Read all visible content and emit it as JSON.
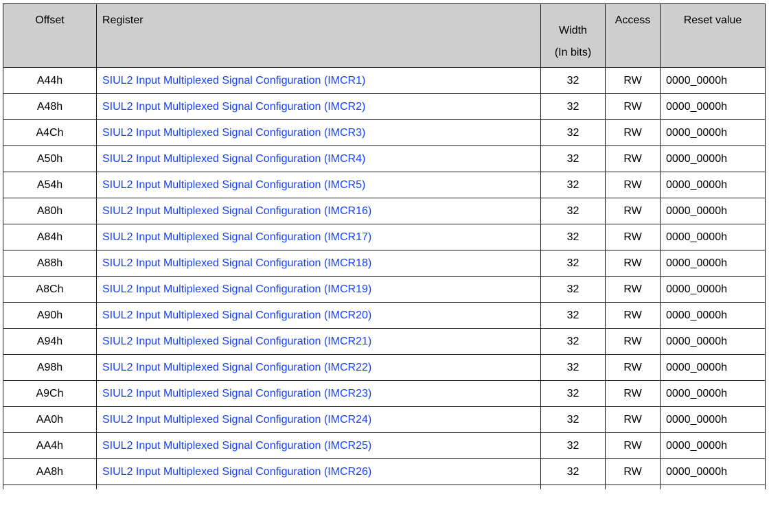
{
  "table": {
    "headers": {
      "offset": "Offset",
      "register": "Register",
      "width_line1": "Width",
      "width_line2": "(In bits)",
      "access": "Access",
      "reset": "Reset value"
    },
    "rows": [
      {
        "offset": "A44h",
        "register": "SIUL2 Input Multiplexed Signal Configuration (IMCR1)",
        "width": "32",
        "access": "RW",
        "reset": "0000_0000h"
      },
      {
        "offset": "A48h",
        "register": "SIUL2 Input Multiplexed Signal Configuration (IMCR2)",
        "width": "32",
        "access": "RW",
        "reset": "0000_0000h"
      },
      {
        "offset": "A4Ch",
        "register": "SIUL2 Input Multiplexed Signal Configuration (IMCR3)",
        "width": "32",
        "access": "RW",
        "reset": "0000_0000h"
      },
      {
        "offset": "A50h",
        "register": "SIUL2 Input Multiplexed Signal Configuration (IMCR4)",
        "width": "32",
        "access": "RW",
        "reset": "0000_0000h"
      },
      {
        "offset": "A54h",
        "register": "SIUL2 Input Multiplexed Signal Configuration (IMCR5)",
        "width": "32",
        "access": "RW",
        "reset": "0000_0000h"
      },
      {
        "offset": "A80h",
        "register": "SIUL2 Input Multiplexed Signal Configuration (IMCR16)",
        "width": "32",
        "access": "RW",
        "reset": "0000_0000h"
      },
      {
        "offset": "A84h",
        "register": "SIUL2 Input Multiplexed Signal Configuration (IMCR17)",
        "width": "32",
        "access": "RW",
        "reset": "0000_0000h"
      },
      {
        "offset": "A88h",
        "register": "SIUL2 Input Multiplexed Signal Configuration (IMCR18)",
        "width": "32",
        "access": "RW",
        "reset": "0000_0000h"
      },
      {
        "offset": "A8Ch",
        "register": "SIUL2 Input Multiplexed Signal Configuration (IMCR19)",
        "width": "32",
        "access": "RW",
        "reset": "0000_0000h"
      },
      {
        "offset": "A90h",
        "register": "SIUL2 Input Multiplexed Signal Configuration (IMCR20)",
        "width": "32",
        "access": "RW",
        "reset": "0000_0000h"
      },
      {
        "offset": "A94h",
        "register": "SIUL2 Input Multiplexed Signal Configuration (IMCR21)",
        "width": "32",
        "access": "RW",
        "reset": "0000_0000h"
      },
      {
        "offset": "A98h",
        "register": "SIUL2 Input Multiplexed Signal Configuration (IMCR22)",
        "width": "32",
        "access": "RW",
        "reset": "0000_0000h"
      },
      {
        "offset": "A9Ch",
        "register": "SIUL2 Input Multiplexed Signal Configuration (IMCR23)",
        "width": "32",
        "access": "RW",
        "reset": "0000_0000h"
      },
      {
        "offset": "AA0h",
        "register": "SIUL2 Input Multiplexed Signal Configuration (IMCR24)",
        "width": "32",
        "access": "RW",
        "reset": "0000_0000h"
      },
      {
        "offset": "AA4h",
        "register": "SIUL2 Input Multiplexed Signal Configuration (IMCR25)",
        "width": "32",
        "access": "RW",
        "reset": "0000_0000h"
      },
      {
        "offset": "AA8h",
        "register": "SIUL2 Input Multiplexed Signal Configuration (IMCR26)",
        "width": "32",
        "access": "RW",
        "reset": "0000_0000h"
      }
    ]
  },
  "colors": {
    "header_bg": "#cecece",
    "link": "#1440ff",
    "border": "#1a1a1a"
  }
}
